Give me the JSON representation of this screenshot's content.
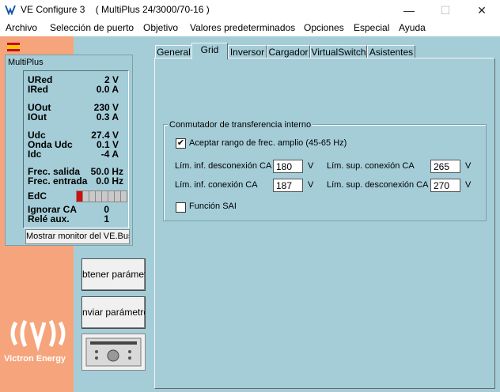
{
  "window": {
    "title": "VE Configure 3    ( MultiPlus 24/3000/70-16 )",
    "minimize": "—",
    "maximize": "☐",
    "close": "✕"
  },
  "menu": [
    "Archivo",
    "Selección de puerto",
    "Objetivo",
    "Valores predeterminados",
    "Opciones",
    "Especial",
    "Ayuda"
  ],
  "monitor": {
    "title": "MultiPlus",
    "rows": [
      {
        "label": "URed",
        "value": "2 V"
      },
      {
        "label": "IRed",
        "value": "0.0 A"
      },
      {
        "label": "UOut",
        "value": "230 V"
      },
      {
        "label": "IOut",
        "value": "0.3 A"
      },
      {
        "label": "Udc",
        "value": "27.4 V"
      },
      {
        "label": "Onda Udc",
        "value": "0.1 V"
      },
      {
        "label": "Idc",
        "value": "-4 A"
      },
      {
        "label": "Frec. salida",
        "value": "50.0 Hz"
      },
      {
        "label": "Frec. entrada",
        "value": "0.0 Hz"
      },
      {
        "label": "EdC",
        "value": ""
      },
      {
        "label": "Ignorar CA",
        "value": "0"
      },
      {
        "label": "Relé aux.",
        "value": "1"
      }
    ],
    "soc_fraction": 0.125,
    "vebus_button": "Mostrar monitor del VE.Bus"
  },
  "buttons": {
    "get_params": "btener parámetr",
    "send_params": "nviar parámetro"
  },
  "logo": {
    "text": "Victron Energy"
  },
  "tabs": [
    "General",
    "Grid",
    "Inversor",
    "Cargador",
    "VirtualSwitch",
    "Asistentes"
  ],
  "active_tab": "Grid",
  "grid": {
    "group_title": "Conmutador de transferencia interno",
    "wide_range": {
      "label": "Aceptar rango de frec. amplio (45-65 Hz)",
      "checked": true
    },
    "low_disconnect": {
      "label": "Lím. inf. desconexión CA",
      "value": "180",
      "unit": "V"
    },
    "low_connect": {
      "label": "Lím. inf. conexión CA",
      "value": "187",
      "unit": "V"
    },
    "high_connect": {
      "label": "Lím. sup. conexión CA",
      "value": "265",
      "unit": "V"
    },
    "high_disconnect": {
      "label": "Lím. sup. desconexión CA",
      "value": "270",
      "unit": "V"
    },
    "ups": {
      "label": "Función SAI",
      "checked": false
    }
  },
  "colors": {
    "panel": "#a4cdd8",
    "sidebar": "#f6a47b",
    "soc_fill": "#cc1010"
  }
}
